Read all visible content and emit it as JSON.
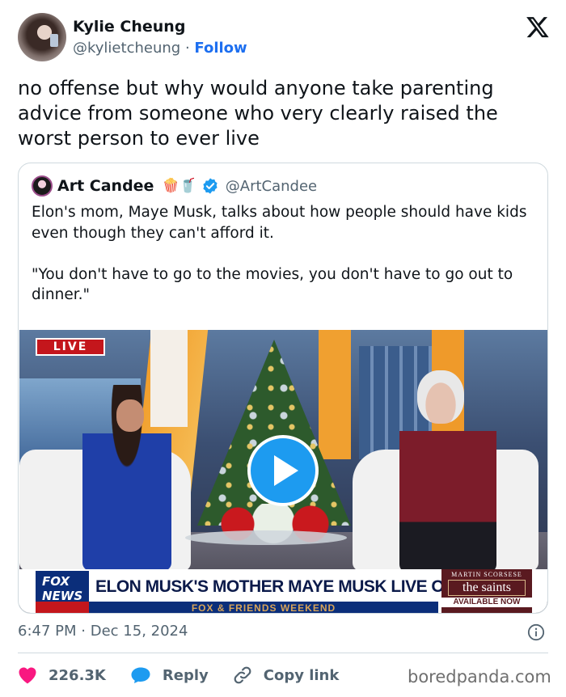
{
  "author": {
    "name": "Kylie Cheung",
    "handle": "@kylietcheung",
    "separator": "·",
    "follow_label": "Follow"
  },
  "tweet": {
    "text": "no offense but why would anyone take parenting advice from someone who very clearly raised the worst person to ever live"
  },
  "quoted": {
    "name": "Art Candee",
    "emojis": "🍿🥤",
    "handle": "@ArtCandee",
    "text": "Elon's mom, Maye Musk, talks about how people should have kids even though they can't afford it.\n\n\"You don't have to go to the movies, you don't have to go out to dinner.\"",
    "video": {
      "live_badge": "LIVE",
      "network_logo": "FOX NEWS",
      "headline": "ELON MUSK'S MOTHER MAYE MUSK LIVE ON F&F",
      "subbar": "FOX & FRIENDS WEEKEND",
      "promo_top": "MARTIN SCORSESE",
      "promo_title": "the saints",
      "promo_avail": "AVAILABLE NOW"
    }
  },
  "meta": {
    "time": "6:47 PM",
    "separator": "·",
    "date": "Dec 15, 2024"
  },
  "actions": {
    "likes": "226.3K",
    "reply": "Reply",
    "copy_link": "Copy link"
  },
  "watermark": "boredpanda.com",
  "colors": {
    "link_blue": "#1d6ff0",
    "like_red": "#f91880",
    "reply_blue": "#1d9bf0",
    "muted_text": "#536471",
    "border": "#cfd9de"
  }
}
